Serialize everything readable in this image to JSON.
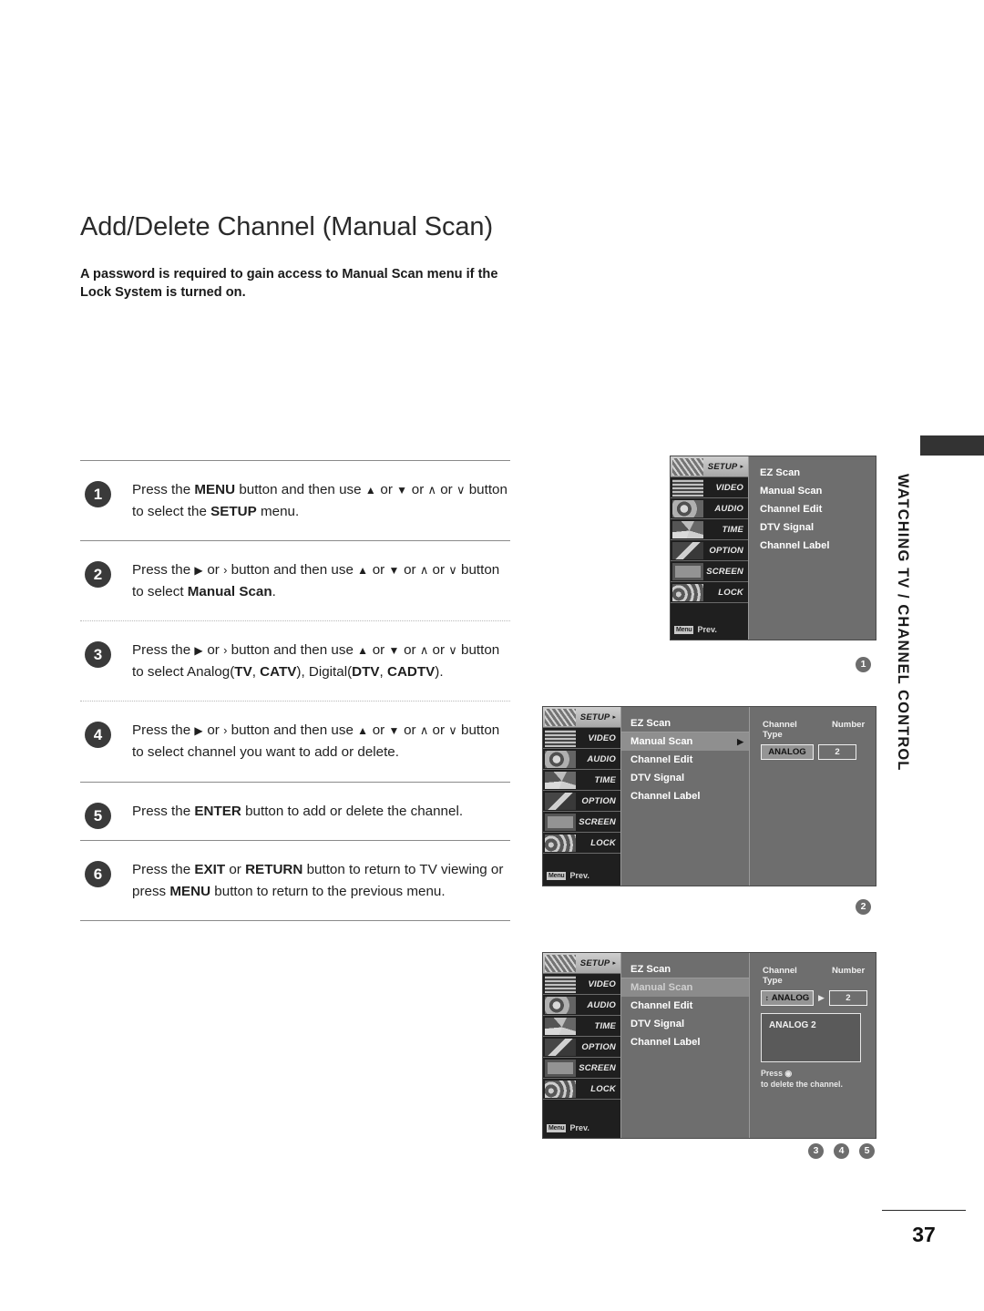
{
  "page": {
    "title": "Add/Delete Channel (Manual Scan)",
    "intro": "A password is required to gain access to Manual Scan menu if the Lock System is turned on.",
    "side_tab": "WATCHING TV / CHANNEL CONTROL",
    "page_number": "37"
  },
  "steps": [
    {
      "number": "1",
      "parts": [
        {
          "t": "Press the ",
          "b": false
        },
        {
          "t": "MENU",
          "b": true
        },
        {
          "t": " button and then use ",
          "b": false
        },
        {
          "t": "▲",
          "b": false,
          "g": "tri"
        },
        {
          "t": " or ",
          "b": false
        },
        {
          "t": "▼",
          "b": false,
          "g": "tri"
        },
        {
          "t": " or ",
          "b": false
        },
        {
          "t": "∧",
          "b": false,
          "g": "ch"
        },
        {
          "t": " or ",
          "b": false
        },
        {
          "t": "∨",
          "b": false,
          "g": "ch"
        },
        {
          "t": " button to select the ",
          "b": false
        },
        {
          "t": "SETUP",
          "b": true
        },
        {
          "t": " menu.",
          "b": false
        }
      ]
    },
    {
      "number": "2",
      "parts": [
        {
          "t": "Press the ",
          "b": false
        },
        {
          "t": "▶",
          "b": false,
          "g": "tri"
        },
        {
          "t": " or ",
          "b": false
        },
        {
          "t": "›",
          "b": false,
          "g": "ch"
        },
        {
          "t": " button and then use ",
          "b": false
        },
        {
          "t": "▲",
          "b": false,
          "g": "tri"
        },
        {
          "t": " or ",
          "b": false
        },
        {
          "t": "▼",
          "b": false,
          "g": "tri"
        },
        {
          "t": " or ",
          "b": false
        },
        {
          "t": "∧",
          "b": false,
          "g": "ch"
        },
        {
          "t": " or ",
          "b": false
        },
        {
          "t": "∨",
          "b": false,
          "g": "ch"
        },
        {
          "t": " button to select ",
          "b": false
        },
        {
          "t": "Manual Scan",
          "b": true
        },
        {
          "t": ".",
          "b": false
        }
      ]
    },
    {
      "number": "3",
      "parts": [
        {
          "t": "Press the ",
          "b": false
        },
        {
          "t": "▶",
          "b": false,
          "g": "tri"
        },
        {
          "t": " or ",
          "b": false
        },
        {
          "t": "›",
          "b": false,
          "g": "ch"
        },
        {
          "t": " button and then use ",
          "b": false
        },
        {
          "t": "▲",
          "b": false,
          "g": "tri"
        },
        {
          "t": " or ",
          "b": false
        },
        {
          "t": "▼",
          "b": false,
          "g": "tri"
        },
        {
          "t": " or ",
          "b": false
        },
        {
          "t": "∧",
          "b": false,
          "g": "ch"
        },
        {
          "t": " or ",
          "b": false
        },
        {
          "t": "∨",
          "b": false,
          "g": "ch"
        },
        {
          "t": " button to select Analog(",
          "b": false
        },
        {
          "t": "TV",
          "b": true
        },
        {
          "t": ", ",
          "b": false
        },
        {
          "t": "CATV",
          "b": true
        },
        {
          "t": "), Digital(",
          "b": false
        },
        {
          "t": "DTV",
          "b": true
        },
        {
          "t": ", ",
          "b": false
        },
        {
          "t": "CADTV",
          "b": true
        },
        {
          "t": ").",
          "b": false
        }
      ]
    },
    {
      "number": "4",
      "parts": [
        {
          "t": "Press the ",
          "b": false
        },
        {
          "t": "▶",
          "b": false,
          "g": "tri"
        },
        {
          "t": " or ",
          "b": false
        },
        {
          "t": "›",
          "b": false,
          "g": "ch"
        },
        {
          "t": " button and then use ",
          "b": false
        },
        {
          "t": "▲",
          "b": false,
          "g": "tri"
        },
        {
          "t": " or ",
          "b": false
        },
        {
          "t": "▼",
          "b": false,
          "g": "tri"
        },
        {
          "t": " or ",
          "b": false
        },
        {
          "t": "∧",
          "b": false,
          "g": "ch"
        },
        {
          "t": " or ",
          "b": false
        },
        {
          "t": "∨",
          "b": false,
          "g": "ch"
        },
        {
          "t": " button to select channel you want to add or delete.",
          "b": false
        }
      ]
    },
    {
      "number": "5",
      "parts": [
        {
          "t": "Press the ",
          "b": false
        },
        {
          "t": "ENTER",
          "b": true
        },
        {
          "t": " button to add or delete the channel.",
          "b": false
        }
      ]
    },
    {
      "number": "6",
      "parts": [
        {
          "t": "Press the ",
          "b": false
        },
        {
          "t": "EXIT",
          "b": true
        },
        {
          "t": " or ",
          "b": false
        },
        {
          "t": "RETURN",
          "b": true
        },
        {
          "t": " button to return to TV viewing or press ",
          "b": false
        },
        {
          "t": "MENU",
          "b": true
        },
        {
          "t": " button to return to the previous menu.",
          "b": false
        }
      ]
    }
  ],
  "osd": {
    "sidebar_items": [
      {
        "label": "SETUP",
        "active": true,
        "arrow": "▸"
      },
      {
        "label": "VIDEO",
        "active": false,
        "arrow": ""
      },
      {
        "label": "AUDIO",
        "active": false,
        "arrow": ""
      },
      {
        "label": "TIME",
        "active": false,
        "arrow": ""
      },
      {
        "label": "OPTION",
        "active": false,
        "arrow": ""
      },
      {
        "label": "SCREEN",
        "active": false,
        "arrow": ""
      },
      {
        "label": "LOCK",
        "active": false,
        "arrow": ""
      }
    ],
    "prev_key": "Menu",
    "prev_label": "Prev.",
    "menu_items": [
      "EZ Scan",
      "Manual Scan",
      "Channel Edit",
      "DTV Signal",
      "Channel Label"
    ],
    "item_arrow": "▶",
    "field_labels": {
      "channel_type": "Channel Type",
      "number": "Number"
    },
    "values": {
      "channel_type": "ANALOG",
      "number": "2",
      "updown_glyph": "↕",
      "play_glyph": "▶"
    },
    "result_text": "ANALOG  2",
    "hint_line1": "Press ◉",
    "hint_line2": "to delete the channel."
  },
  "figure_badges": [
    "1",
    "2",
    "3",
    "4",
    "5"
  ]
}
